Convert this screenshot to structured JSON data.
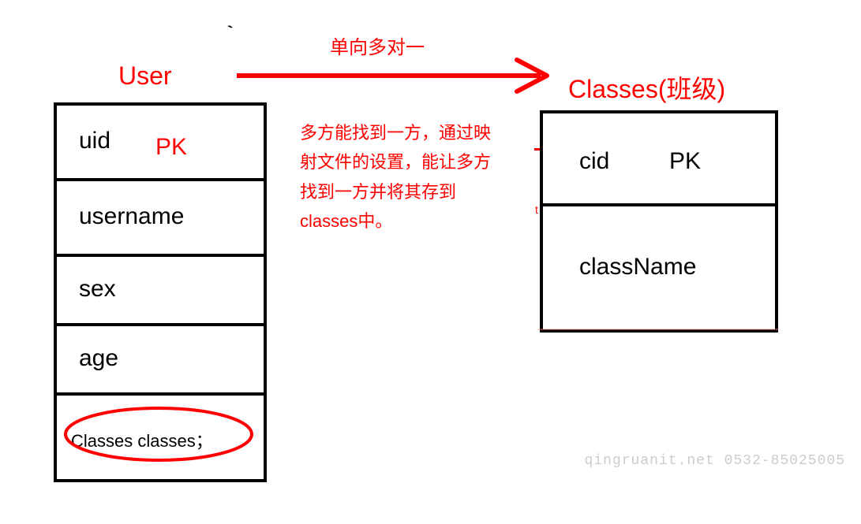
{
  "diagram": {
    "relation_label": "单向多对一",
    "description": "多方能找到一方，通过映射文件的设置，能让多方找到一方并将其存到classes中。",
    "left_entity": {
      "title": "User",
      "rows": [
        {
          "field": "uid",
          "pk": "PK"
        },
        {
          "field": "username"
        },
        {
          "field": "sex"
        },
        {
          "field": "age"
        },
        {
          "field": "Classes classes；",
          "circled": true
        }
      ]
    },
    "right_entity": {
      "title": "Classes(班级)",
      "rows": [
        {
          "field": "cid",
          "pk": "PK"
        },
        {
          "field": "className"
        }
      ]
    }
  },
  "watermark": "qingruanit.net 0532-85025005"
}
